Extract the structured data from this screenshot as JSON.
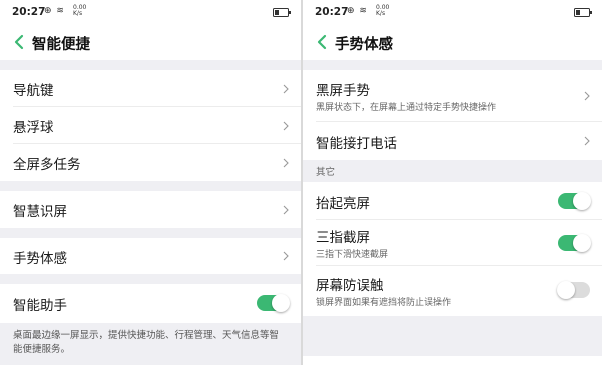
{
  "left": {
    "status": {
      "time": "20:27",
      "speed_top": "0.00",
      "speed_bottom": "K/s"
    },
    "title": "智能便捷",
    "items": [
      {
        "label": "导航键"
      },
      {
        "label": "悬浮球"
      },
      {
        "label": "全屏多任务"
      },
      {
        "label": "智慧识屏"
      },
      {
        "label": "手势体感"
      },
      {
        "label": "智能助手",
        "toggle": "on"
      }
    ],
    "assistant_description": "桌面最边缘一屏显示，提供快捷功能、行程管理、天气信息等智能便捷服务。"
  },
  "right": {
    "status": {
      "time": "20:27",
      "speed_top": "0.00",
      "speed_bottom": "K/s"
    },
    "title": "手势体感",
    "items": [
      {
        "label": "黑屏手势",
        "sub": "黑屏状态下，在屏幕上通过特定手势快捷操作"
      },
      {
        "label": "智能接打电话"
      }
    ],
    "section_label": "其它",
    "toggles": [
      {
        "label": "抬起亮屏",
        "state": "on"
      },
      {
        "label": "三指截屏",
        "sub": "三指下滑快速截屏",
        "state": "on"
      },
      {
        "label": "屏幕防误触",
        "sub": "锁屏界面如果有遮挡将防止误操作",
        "state": "off"
      }
    ]
  }
}
